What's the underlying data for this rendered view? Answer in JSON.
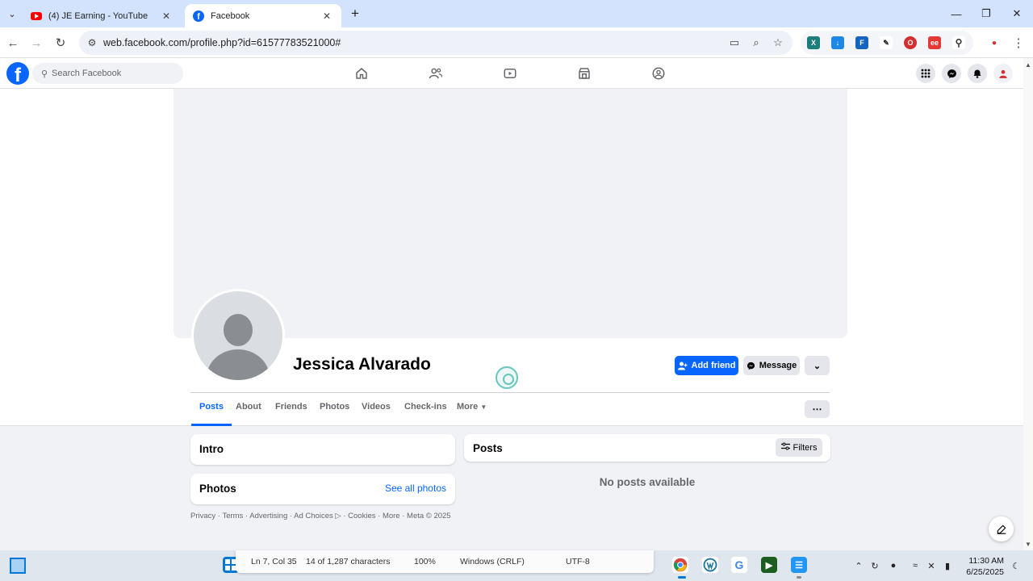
{
  "browser": {
    "tabs": [
      {
        "title": "(4) JE Earning - YouTube",
        "active": false
      },
      {
        "title": "Facebook",
        "active": true
      }
    ],
    "url": "web.facebook.com/profile.php?id=61577783521000#"
  },
  "fb_header": {
    "search_placeholder": "Search Facebook"
  },
  "profile": {
    "name": "Jessica Alvarado",
    "add_friend_label": "Add friend",
    "message_label": "Message",
    "tabs": [
      "Posts",
      "About",
      "Friends",
      "Photos",
      "Videos",
      "Check-ins",
      "More"
    ],
    "active_tab": "Posts"
  },
  "intro": {
    "title": "Intro"
  },
  "photos": {
    "title": "Photos",
    "see_all": "See all photos"
  },
  "posts": {
    "title": "Posts",
    "filters_label": "Filters",
    "empty_text": "No posts available"
  },
  "footer": {
    "links": [
      "Privacy",
      "Terms",
      "Advertising",
      "Ad Choices",
      "Cookies",
      "More",
      "Meta © 2025"
    ]
  },
  "notepad_status": {
    "position": "Ln 7, Col 35",
    "chars": "14 of 1,287 characters",
    "zoom": "100%",
    "line_ending": "Windows (CRLF)",
    "encoding": "UTF-8"
  },
  "clock": {
    "time": "11:30 AM",
    "date": "6/25/2025"
  },
  "colors": {
    "fb_blue": "#0866ff",
    "chrome_tabstrip": "#d3e3fd",
    "fb_bg": "#f0f2f5"
  }
}
